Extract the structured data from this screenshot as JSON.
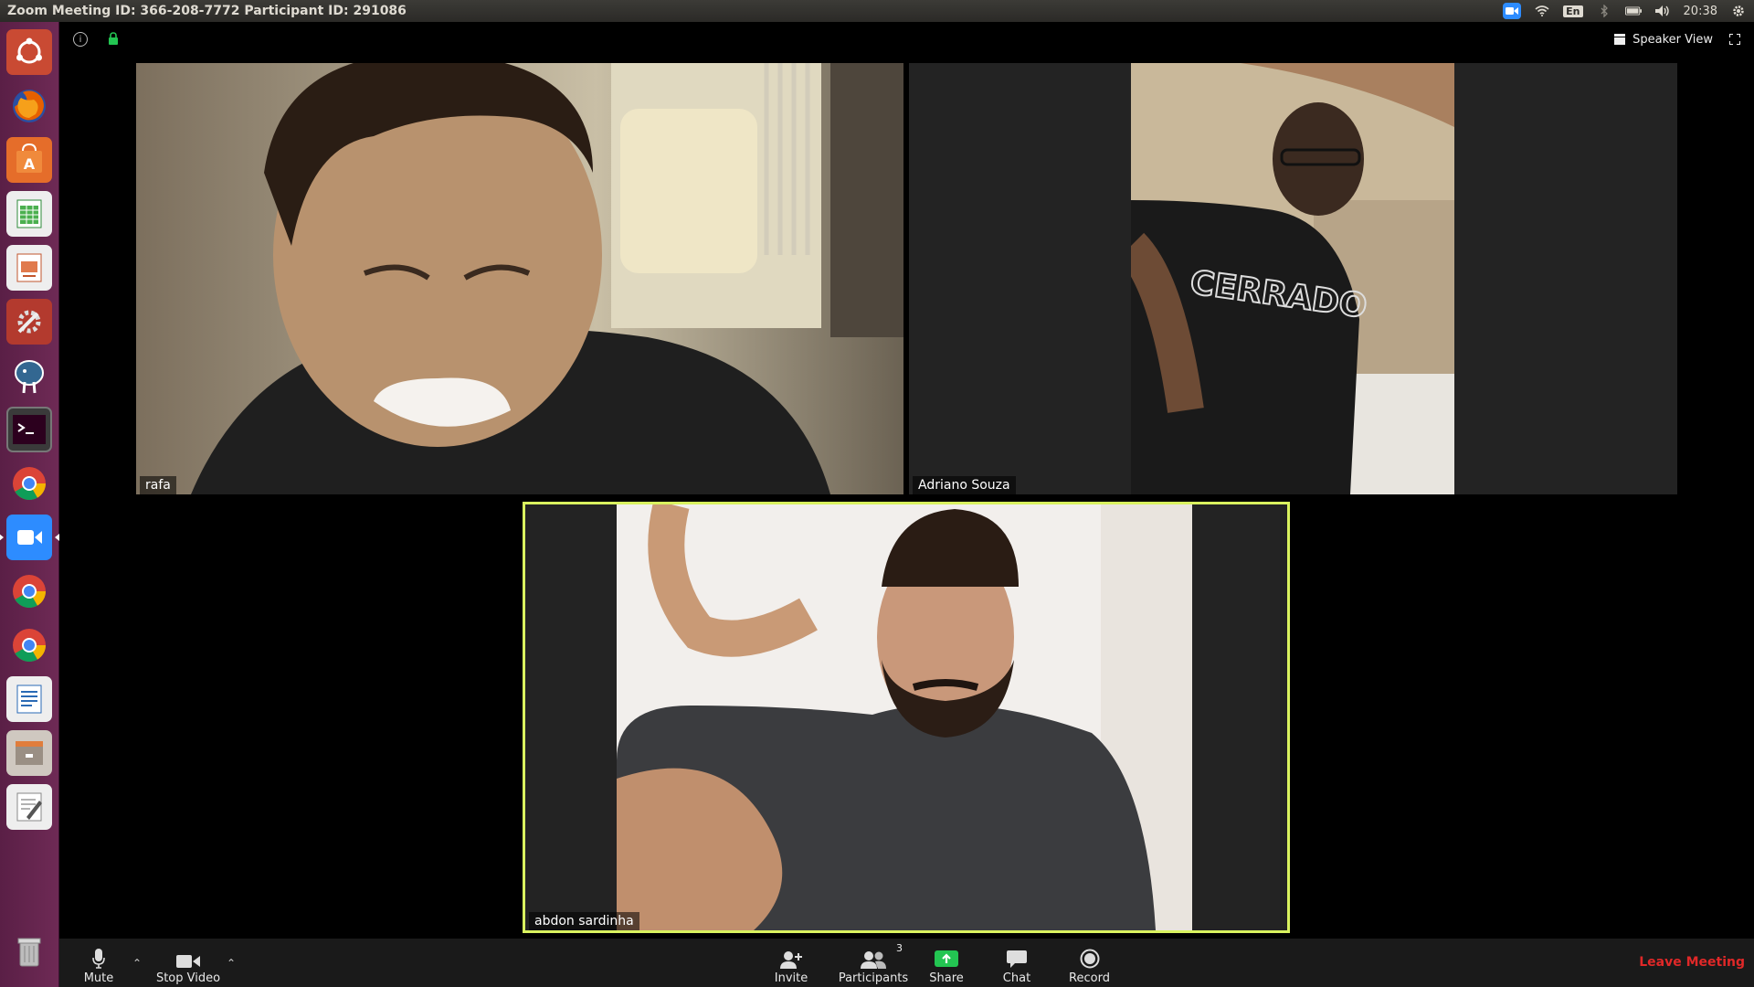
{
  "topbar": {
    "title": "Zoom Meeting ID: 366-208-7772 Participant ID: 291086",
    "language": "En",
    "clock": "20:38"
  },
  "launcher": {
    "apps": [
      "ubuntu-home-icon",
      "firefox-icon",
      "software-center-icon",
      "calc-icon",
      "impress-icon",
      "settings-icon",
      "pgadmin-icon",
      "terminal-icon",
      "chrome-icon",
      "zoom-icon",
      "chrome-icon",
      "chrome-icon",
      "writer-icon",
      "archive-icon",
      "text-editor-icon",
      "trash-icon"
    ]
  },
  "meeting": {
    "view_label": "Speaker View",
    "participants": [
      {
        "name": "rafa"
      },
      {
        "name": "Adriano Souza"
      },
      {
        "name": "abdon sardinha"
      }
    ]
  },
  "toolbar": {
    "mute_label": "Mute",
    "stop_video_label": "Stop Video",
    "invite_label": "Invite",
    "participants_label": "Participants",
    "participants_count": "3",
    "share_label": "Share",
    "chat_label": "Chat",
    "record_label": "Record",
    "leave_label": "Leave Meeting"
  },
  "colors": {
    "active_speaker_border": "#d9f25f",
    "share_green": "#23c552",
    "leave_red": "#e02828",
    "launcher_bg": "#5a1f46"
  }
}
